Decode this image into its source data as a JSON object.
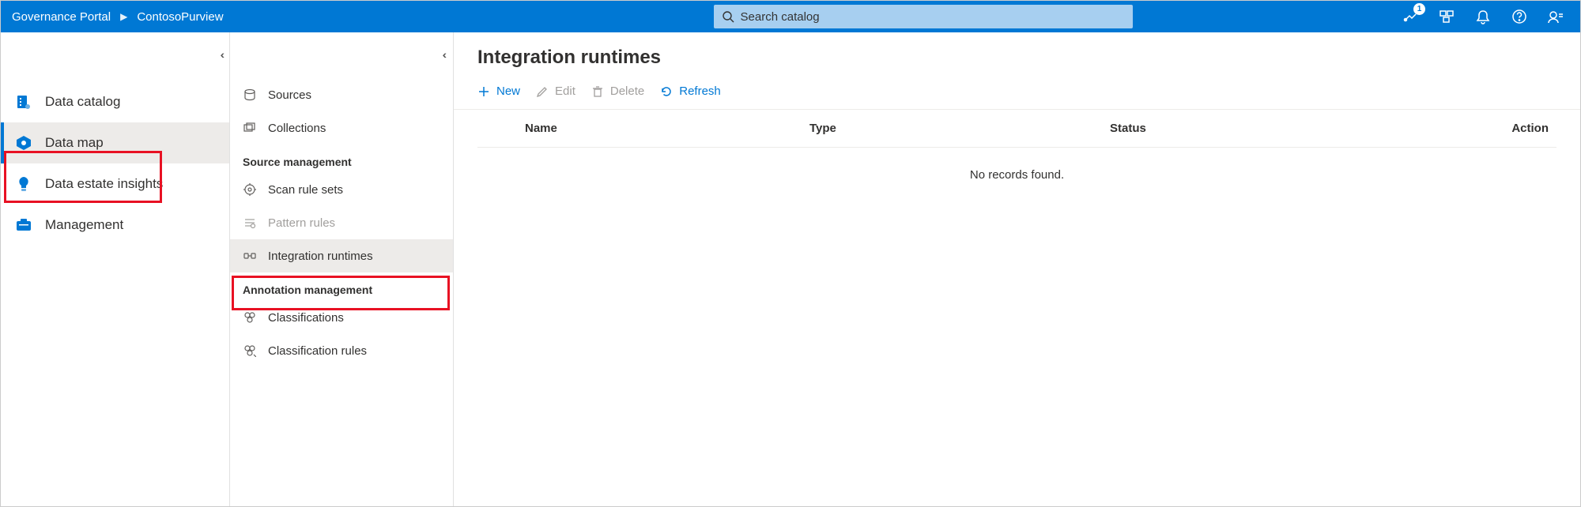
{
  "header": {
    "breadcrumb": [
      "Governance Portal",
      "ContosoPurview"
    ],
    "search_placeholder": "Search catalog",
    "badge_count": "1"
  },
  "sidebar1": {
    "items": [
      {
        "label": "Data catalog"
      },
      {
        "label": "Data map"
      },
      {
        "label": "Data estate insights"
      },
      {
        "label": "Management"
      }
    ]
  },
  "sidebar2": {
    "items": [
      {
        "label": "Sources"
      },
      {
        "label": "Collections"
      }
    ],
    "group1": {
      "title": "Source management",
      "items": [
        {
          "label": "Scan rule sets"
        },
        {
          "label": "Pattern rules"
        },
        {
          "label": "Integration runtimes"
        }
      ]
    },
    "group2": {
      "title": "Annotation management",
      "items": [
        {
          "label": "Classifications"
        },
        {
          "label": "Classification rules"
        }
      ]
    }
  },
  "main": {
    "title": "Integration runtimes",
    "toolbar": {
      "new": "New",
      "edit": "Edit",
      "delete": "Delete",
      "refresh": "Refresh"
    },
    "columns": {
      "name": "Name",
      "type": "Type",
      "status": "Status",
      "action": "Action"
    },
    "empty": "No records found."
  }
}
